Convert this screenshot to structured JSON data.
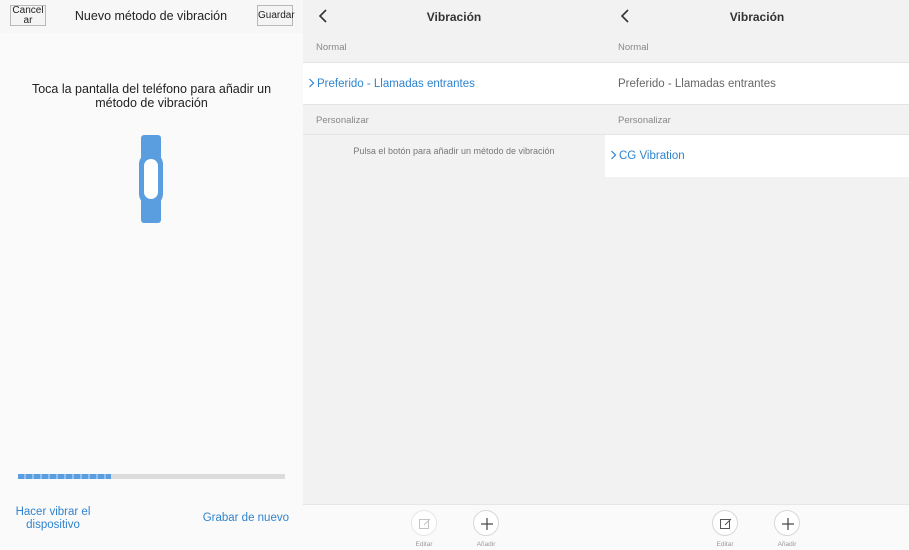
{
  "left_panel": {
    "cancel_label": "Cancelar",
    "title": "Nuevo método de vibración",
    "save_label": "Guardar",
    "instruction": "Toca la pantalla del teléfono para añadir un método de vibración",
    "progress": 0.35,
    "vibrate_link": "Hacer vibrar el dispositivo",
    "rerecord_link": "Grabar de nuevo",
    "icon": "band-icon"
  },
  "middle_panel": {
    "title": "Vibración",
    "section_normal": "Normal",
    "normal_item": "Preferido - Llamadas entrantes",
    "section_custom": "Personalizar",
    "custom_hint": "Pulsa el botón para añadir un método de vibración",
    "edit_label": "Editar",
    "add_label": "Añadir"
  },
  "right_panel": {
    "title": "Vibración",
    "section_normal": "Normal",
    "normal_item": "Preferido - Llamadas entrantes",
    "section_custom": "Personalizar",
    "custom_item": "CG Vibration",
    "edit_label": "Editar",
    "add_label": "Añadir"
  },
  "colors": {
    "accent": "#2f83cf",
    "band": "#5a9ee0"
  }
}
